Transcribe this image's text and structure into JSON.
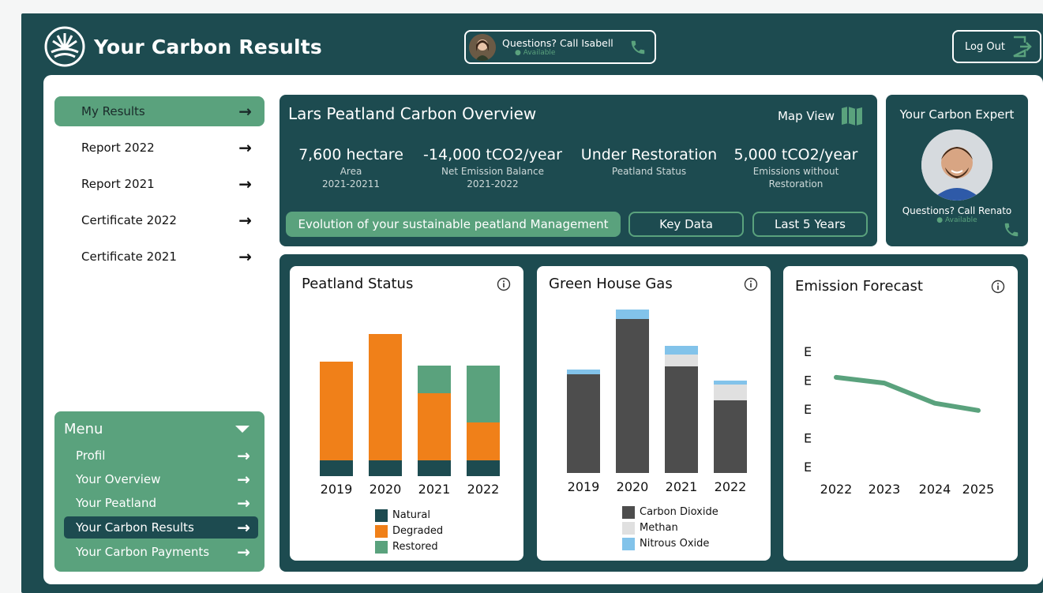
{
  "header": {
    "title": "Your Carbon Results",
    "call_label": "Questions? Call Isabell",
    "call_status": "Available",
    "logout": "Log Out"
  },
  "sidebar": {
    "items": [
      {
        "label": "My Results"
      },
      {
        "label": "Report 2022"
      },
      {
        "label": "Report 2021"
      },
      {
        "label": "Certificate 2022"
      },
      {
        "label": "Certificate 2021"
      }
    ]
  },
  "menu": {
    "title": "Menu",
    "items": [
      {
        "label": "Profil"
      },
      {
        "label": "Your Overview"
      },
      {
        "label": "Your Peatland"
      },
      {
        "label": "Your Carbon Results"
      },
      {
        "label": "Your Carbon Payments"
      }
    ]
  },
  "overview": {
    "title": "Lars Peatland Carbon Overview",
    "map_view": "Map View",
    "kpis": [
      {
        "value": "7,600 hectare",
        "label1": "Area",
        "label2": "2021-20211"
      },
      {
        "value": "-14,000 tCO2/year",
        "label1": "Net Emission Balance",
        "label2": "2021-2022"
      },
      {
        "value": "Under Restoration",
        "label1": "Peatland Status",
        "label2": ""
      },
      {
        "value": "5,000 tCO2/year",
        "label1": "Emissions without",
        "label2": "Restoration"
      }
    ],
    "pill_main": "Evolution of your sustainable peatland Management",
    "pill_key": "Key Data",
    "pill_years": "Last 5 Years"
  },
  "expert": {
    "title": "Your Carbon Expert",
    "question": "Questions? Call Renato",
    "status": "Available"
  },
  "colors": {
    "dark": "#1d4b50",
    "green": "#5aa27d",
    "orange": "#f08019",
    "gray": "#4d4d4d",
    "light_gray": "#e0e0e0",
    "blue": "#82c3ea"
  },
  "chart_data": [
    {
      "type": "bar",
      "title": "Peatland Status",
      "categories": [
        "2019",
        "2020",
        "2021",
        "2022"
      ],
      "stacked": true,
      "series": [
        {
          "name": "Natural",
          "values": [
            20,
            20,
            20,
            20
          ]
        },
        {
          "name": "Degraded",
          "values": [
            125,
            160,
            85,
            48
          ]
        },
        {
          "name": "Restored",
          "values": [
            0,
            0,
            35,
            72
          ]
        }
      ]
    },
    {
      "type": "bar",
      "title": "Green House Gas",
      "categories": [
        "2019",
        "2020",
        "2021",
        "2022"
      ],
      "stacked": true,
      "series": [
        {
          "name": "Carbon Dioxide",
          "values": [
            125,
            195,
            135,
            92
          ]
        },
        {
          "name": "Methan",
          "values": [
            0,
            0,
            15,
            20
          ]
        },
        {
          "name": "Nitrous Oxide",
          "values": [
            6,
            12,
            11,
            5
          ]
        }
      ]
    },
    {
      "type": "line",
      "title": "Emission Forecast",
      "x": [
        "2022",
        "2023",
        "2024",
        "2025"
      ],
      "y_ticks": [
        "E",
        "E",
        "E",
        "E",
        "E"
      ],
      "series": [
        {
          "values": [
            4.1,
            3.9,
            3.2,
            2.95
          ]
        }
      ],
      "ylim": [
        1,
        5
      ]
    }
  ]
}
